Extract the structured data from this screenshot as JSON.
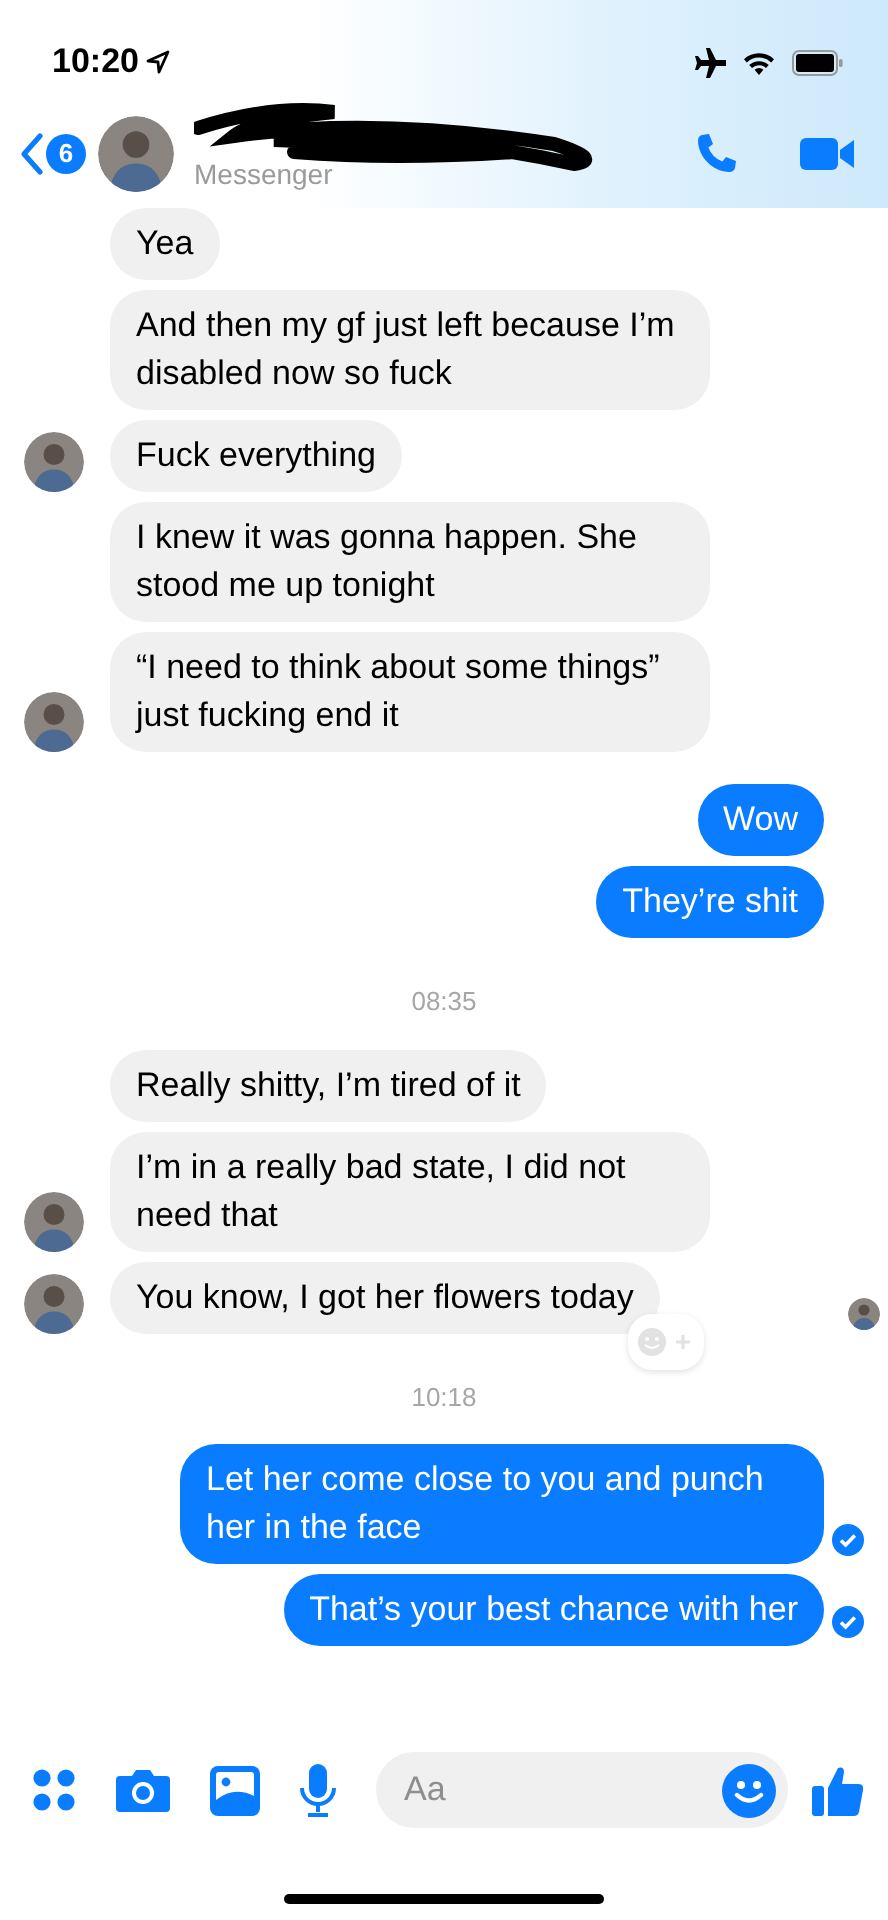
{
  "status_bar": {
    "time": "10:20"
  },
  "header": {
    "unread_count": "6",
    "subtitle": "Messenger",
    "name_redacted": true
  },
  "messages": [
    {
      "kind": "in",
      "text": "Yea",
      "avatar": false,
      "seen_by": false,
      "reaction_button": false
    },
    {
      "kind": "in",
      "text": "And then my gf just left because I’m disabled now so fuck",
      "avatar": false,
      "seen_by": false,
      "reaction_button": false
    },
    {
      "kind": "in",
      "text": "Fuck everything",
      "avatar": true,
      "seen_by": false,
      "reaction_button": false
    },
    {
      "kind": "in",
      "text": "I knew it was gonna happen. She stood me up tonight",
      "avatar": false,
      "seen_by": false,
      "reaction_button": false
    },
    {
      "kind": "in",
      "text": "“I need to think about some things” just fucking end it",
      "avatar": true,
      "seen_by": false,
      "reaction_button": false
    },
    {
      "kind": "out",
      "text": "Wow",
      "delivered": false
    },
    {
      "kind": "out",
      "text": "They’re shit",
      "delivered": false
    },
    {
      "kind": "time",
      "text": "08:35"
    },
    {
      "kind": "in",
      "text": "Really shitty, I’m tired of it",
      "avatar": false,
      "seen_by": false,
      "reaction_button": false
    },
    {
      "kind": "in",
      "text": "I’m in a really bad state, I did not need that",
      "avatar": true,
      "seen_by": false,
      "reaction_button": false
    },
    {
      "kind": "in",
      "text": "You know, I got her flowers today",
      "avatar": true,
      "seen_by": true,
      "reaction_button": true
    },
    {
      "kind": "time",
      "text": "10:18"
    },
    {
      "kind": "out",
      "text": "Let her come close to you and punch her in the face",
      "delivered": true
    },
    {
      "kind": "out",
      "text": "That’s your best chance with her",
      "delivered": true
    }
  ],
  "composer": {
    "placeholder": "Aa"
  }
}
